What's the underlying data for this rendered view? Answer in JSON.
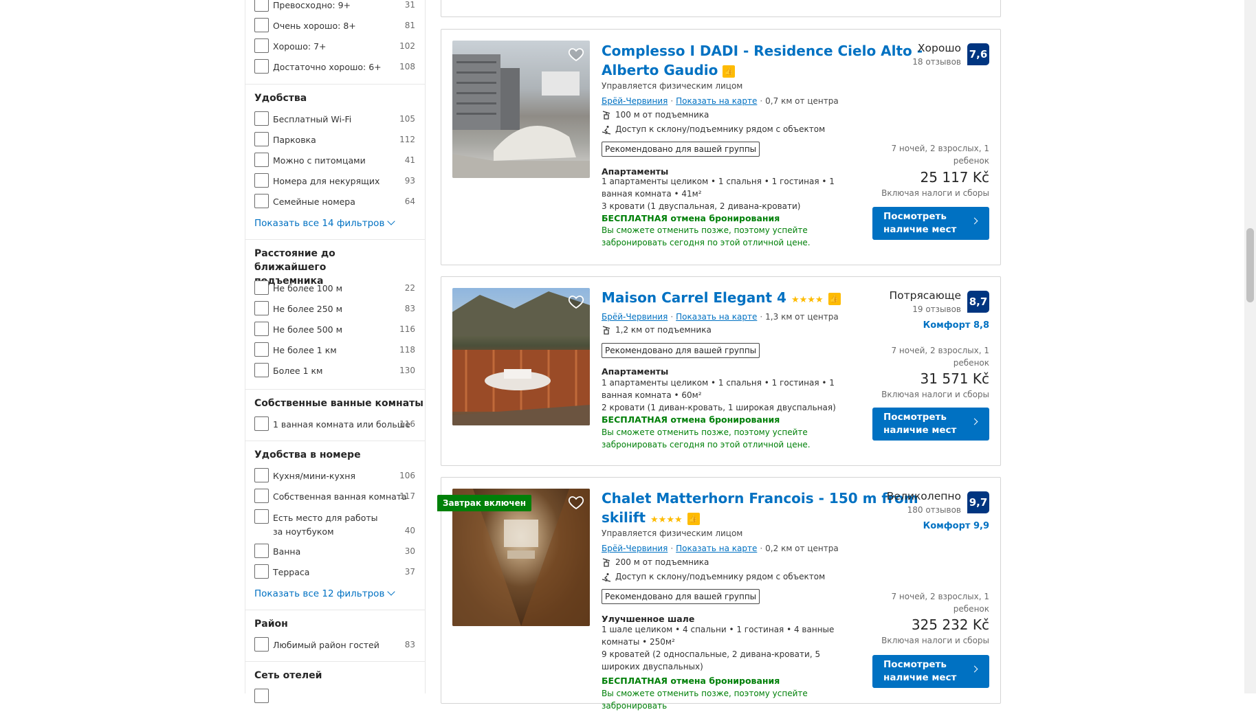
{
  "filters": {
    "rating": [
      {
        "label": "Превосходно: 9+",
        "count": "31"
      },
      {
        "label": "Очень хорошо: 8+",
        "count": "81"
      },
      {
        "label": "Хорошо: 7+",
        "count": "102"
      },
      {
        "label": "Достаточно хорошо: 6+",
        "count": "108"
      }
    ],
    "facilities": {
      "title": "Удобства",
      "items": [
        {
          "label": "Бесплатный Wi-Fi",
          "count": "105"
        },
        {
          "label": "Парковка",
          "count": "112"
        },
        {
          "label": "Можно с питомцами",
          "count": "41"
        },
        {
          "label": "Номера для некурящих",
          "count": "93"
        },
        {
          "label": "Семейные номера",
          "count": "64"
        }
      ],
      "show_all": "Показать все 14 фильтров"
    },
    "lift_distance": {
      "title": "Расстояние до ближайшего подъемника",
      "items": [
        {
          "label": "Не более 100 м",
          "count": "22"
        },
        {
          "label": "Не более 250 м",
          "count": "83"
        },
        {
          "label": "Не более 500 м",
          "count": "116"
        },
        {
          "label": "Не более 1 км",
          "count": "118"
        },
        {
          "label": "Более 1 км",
          "count": "130"
        }
      ]
    },
    "bathrooms": {
      "title": "Собственные ванные комнаты",
      "items": [
        {
          "label": "1 ванная комната или больше",
          "count": "116"
        }
      ]
    },
    "room_facilities": {
      "title": "Удобства в номере",
      "items": [
        {
          "label": "Кухня/мини-кухня",
          "count": "106"
        },
        {
          "label": "Собственная ванная комната",
          "count": "117"
        },
        {
          "label": "Есть место для работы за ноутбуком",
          "count": "40"
        },
        {
          "label": "Ванна",
          "count": "30"
        },
        {
          "label": "Терраса",
          "count": "37"
        }
      ],
      "show_all": "Показать все 12 фильтров"
    },
    "district": {
      "title": "Район",
      "items": [
        {
          "label": "Любимый район гостей",
          "count": "83"
        }
      ]
    },
    "chain": {
      "title": "Сеть отелей"
    }
  },
  "cards": [
    {
      "title_line1": "Complesso I DADI - Residence Cielo Alto -",
      "title_line2": "Alberto Gaudio",
      "managed": "Управляется физическим лицом",
      "town": "Брёй-Червиния",
      "map": "Показать на карте",
      "distance": "0,7 км от центра",
      "lift": "100 м от подъемника",
      "slope": "Доступ к склону/подъемнику рядом с объектом",
      "reco": "Рекомендовано для вашей группы",
      "room_type": "Апартаменты",
      "room_desc": "1 апартаменты целиком • 1 спальня • 1 гостиная • 1 ванная комната • 41м²",
      "beds": "3 кровати (1 двуспальная, 2 дивана-кровати)",
      "free_cancel": "БЕСПЛАТНАЯ отмена бронирования",
      "free_desc": "Вы сможете отменить позже, поэтому успейте забронировать сегодня по этой отличной цене.",
      "rating_label": "Хорошо",
      "reviews": "18 отзывов",
      "score": "7,6",
      "nights": "7 ночей, 2 взрослых, 1 ребенок",
      "price": "25 117 Kč",
      "taxes": "Включая налоги и сборы",
      "button": "Посмотреть наличие мест"
    },
    {
      "title_line1": "Maison Carrel Elegant 4",
      "stars": "★★★★",
      "town": "Брёй-Червиния",
      "map": "Показать на карте",
      "distance": "1,3 км от центра",
      "lift": "1,2 км от подъемника",
      "reco": "Рекомендовано для вашей группы",
      "room_type": "Апартаменты",
      "room_desc": "1 апартаменты целиком • 1 спальня • 1 гостиная • 1 ванная комната • 60м²",
      "beds": "2 кровати (1 диван-кровать, 1 широкая двуспальная)",
      "free_cancel": "БЕСПЛАТНАЯ отмена бронирования",
      "free_desc": "Вы сможете отменить позже, поэтому успейте забронировать сегодня по этой отличной цене.",
      "rating_label": "Потрясающе",
      "reviews": "19 отзывов",
      "score": "8,7",
      "comfort": "Комфорт 8,8",
      "nights": "7 ночей, 2 взрослых, 1 ребенок",
      "price": "31 571 Kč",
      "taxes": "Включая налоги и сборы",
      "button": "Посмотреть наличие мест"
    },
    {
      "ribbon": "Завтрак включен",
      "title_line1": "Chalet Matterhorn Francois - 150 m from",
      "title_line2": "skilift",
      "stars": "★★★★",
      "managed": "Управляется физическим лицом",
      "town": "Брёй-Червиния",
      "map": "Показать на карте",
      "distance": "0,2 км от центра",
      "lift": "200 м от подъемника",
      "slope": "Доступ к склону/подъемнику рядом с объектом",
      "reco": "Рекомендовано для вашей группы",
      "room_type": "Улучшенное шале",
      "room_desc": "1 шале целиком • 4 спальни • 1 гостиная • 4 ванные комнаты • 250м²",
      "beds": "9 кроватей (2 односпальные, 2 дивана-кровати, 5 широких двуспальных)",
      "free_cancel": "БЕСПЛАТНАЯ отмена бронирования",
      "free_desc": "Вы сможете отменить позже, поэтому успейте забронировать",
      "rating_label": "Великолепно",
      "reviews": "180 отзывов",
      "score": "9,7",
      "comfort": "Комфорт 9,9",
      "nights": "7 ночей, 2 взрослых, 1 ребенок",
      "price": "325 232 Kč",
      "taxes": "Включая налоги и сборы",
      "button": "Посмотреть наличие мест"
    }
  ],
  "colors": {
    "link": "#0071c2",
    "score_bg": "#003580",
    "green": "#008009",
    "star": "#febb02"
  }
}
